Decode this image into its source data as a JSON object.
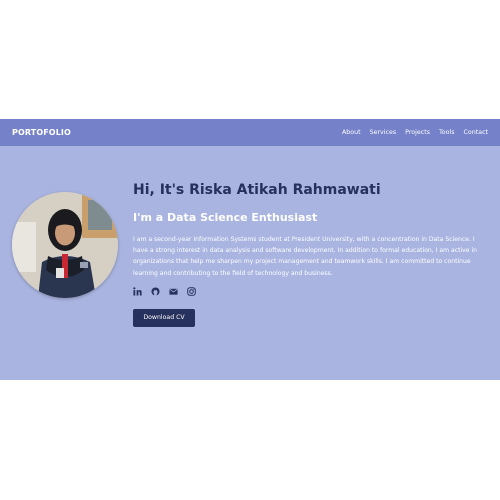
{
  "navbar": {
    "brand": "PORTOFOLIO",
    "links": [
      "About",
      "Services",
      "Projects",
      "Tools",
      "Contact"
    ]
  },
  "hero": {
    "greeting": "Hi, It's Riska Atikah Rahmawati",
    "role": "I'm a Data Science Enthusiast",
    "bio": "I am a second-year Information Systems student at President University, with a concentration in Data Science. I have a strong interest in data analysis and software development. In addition to formal education, I am active in organizations that help me sharpen my project management and teamwork skills. I am committed to continue learning and contributing to the field of technology and business.",
    "socials": [
      "linkedin-icon",
      "github-icon",
      "mail-icon",
      "instagram-icon"
    ],
    "cta_label": "Download CV"
  },
  "colors": {
    "navbar": "#7581c8",
    "background": "#a9b4e0",
    "heading": "#27315e",
    "button": "#27315e"
  }
}
